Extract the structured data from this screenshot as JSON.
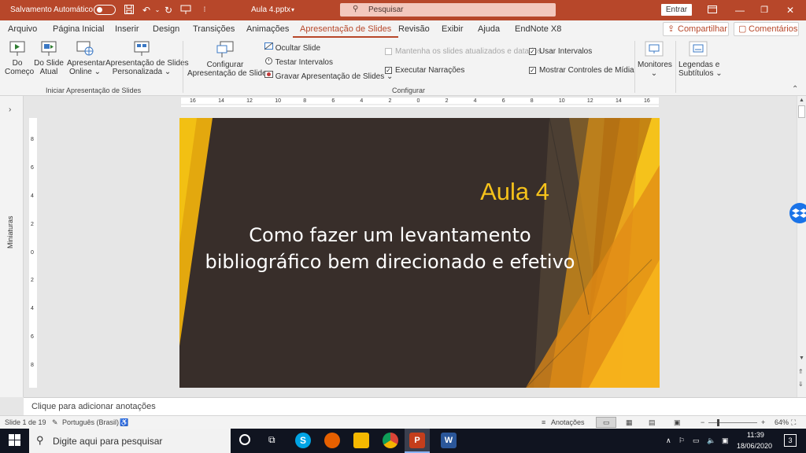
{
  "titlebar": {
    "autosave_label": "Salvamento Automático",
    "file_name": "Aula 4.pptx",
    "search_placeholder": "Pesquisar",
    "signin_label": "Entrar",
    "brand_color": "#b7472a"
  },
  "tabs": {
    "items": [
      "Arquivo",
      "Página Inicial",
      "Inserir",
      "Design",
      "Transições",
      "Animações",
      "Apresentação de Slides",
      "Revisão",
      "Exibir",
      "Ajuda",
      "EndNote X8"
    ],
    "active": "Apresentação de Slides",
    "share_label": "Compartilhar",
    "comments_label": "Comentários"
  },
  "ribbon": {
    "from_start": [
      "Do",
      "Começo"
    ],
    "from_current": [
      "Do Slide",
      "Atual"
    ],
    "present_online": [
      "Apresentar",
      "Online"
    ],
    "custom_show": [
      "Apresentação de Slides",
      "Personalizada"
    ],
    "group_start": "Iniciar Apresentação de Slides",
    "setup": [
      "Configurar",
      "Apresentação de Slides"
    ],
    "hide_slide": "Ocultar Slide",
    "rehearse": "Testar Intervalos",
    "record": "Gravar Apresentação de Slides",
    "keep_updated": "Mantenha os slides atualizados e datados",
    "play_narrations": "Executar Narrações",
    "use_timings": "Usar Intervalos",
    "show_media_controls": "Mostrar Controles de Mídia",
    "group_setup": "Configurar",
    "monitors": "Monitores",
    "captions": [
      "Legendas e",
      "Subtítulos"
    ]
  },
  "panes": {
    "thumbnails_label": "Miniaturas"
  },
  "rulers": {
    "horizontal": [
      "16",
      "14",
      "12",
      "10",
      "8",
      "6",
      "4",
      "2",
      "0",
      "2",
      "4",
      "6",
      "8",
      "10",
      "12",
      "14",
      "16"
    ],
    "vertical": [
      "8",
      "6",
      "4",
      "2",
      "0",
      "2",
      "4",
      "6",
      "8"
    ]
  },
  "slide": {
    "subtitle": "Aula 4",
    "title_line1": "Como fazer um levantamento",
    "title_line2": "bibliográfico bem direcionado e efetivo",
    "accent_color": "#f5c21b",
    "background_color": "#382e2a"
  },
  "notes": {
    "placeholder": "Clique para adicionar anotações"
  },
  "status": {
    "slide_counter": "Slide 1 de 19",
    "language": "Português (Brasil)",
    "notes_label": "Anotações",
    "zoom": "64%"
  },
  "taskbar": {
    "search_placeholder": "Digite aqui para pesquisar",
    "time": "11:39",
    "date": "18/06/2020",
    "notification_count": "3"
  }
}
